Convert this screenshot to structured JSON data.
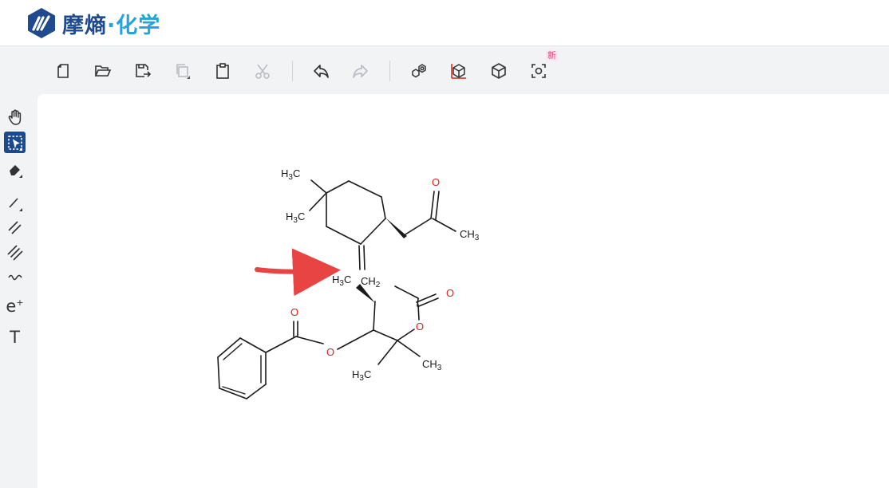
{
  "app": {
    "logo_text_a": "摩熵",
    "logo_dot": "·",
    "logo_text_b": "化学"
  },
  "colors": {
    "brand_dark": "#1f4b8e",
    "brand_light": "#27a3dc",
    "oxygen_red": "#e0201b",
    "arrow_red": "#e84444",
    "active_tool": "#1b4a8d"
  },
  "toolbar": {
    "items": [
      {
        "name": "new-file",
        "icon": "new-file-icon"
      },
      {
        "name": "open-file",
        "icon": "folder-open-icon"
      },
      {
        "name": "save",
        "icon": "save-icon"
      },
      {
        "name": "copy",
        "icon": "copy-icon",
        "disabled": true
      },
      {
        "name": "paste",
        "icon": "clipboard-icon"
      },
      {
        "name": "cut",
        "icon": "scissors-icon",
        "disabled": true
      },
      {
        "name": "undo",
        "icon": "undo-icon"
      },
      {
        "name": "redo",
        "icon": "redo-icon",
        "disabled": true
      },
      {
        "name": "clean-structure",
        "icon": "clean-structure-icon"
      },
      {
        "name": "3d-view",
        "icon": "3d-axis-icon"
      },
      {
        "name": "3d-model",
        "icon": "cube-icon"
      },
      {
        "name": "recognize",
        "icon": "scan-icon"
      }
    ],
    "new_badge": "新"
  },
  "left_tools": {
    "items": [
      {
        "name": "hand",
        "icon": "hand-icon"
      },
      {
        "name": "select",
        "icon": "select-icon",
        "active": true
      },
      {
        "name": "eraser",
        "icon": "eraser-icon"
      },
      {
        "name": "single-bond",
        "icon": "single-bond-icon"
      },
      {
        "name": "double-bond",
        "icon": "double-bond-icon"
      },
      {
        "name": "triple-bond",
        "icon": "triple-bond-icon"
      },
      {
        "name": "wavy-bond",
        "icon": "wavy-bond-icon"
      },
      {
        "name": "charge",
        "icon": "charge-icon"
      },
      {
        "name": "text",
        "icon": "text-icon"
      }
    ],
    "charge_label": "e",
    "charge_sup": "+",
    "text_label": "T"
  },
  "molecule": {
    "labels": {
      "h3c_top": "H3C",
      "h3c_mid": "H3C",
      "o_ketone": "O",
      "ch3_ketone": "CH3",
      "h3c_ch2_left": "H3C",
      "ch2": "CH2",
      "o_lactone_carbonyl": "O",
      "o_ester_carbonyl": "O",
      "o_ester": "O",
      "o_ring": "O",
      "h3c_bottom": "H3C",
      "ch3_bottom": "CH3"
    }
  }
}
